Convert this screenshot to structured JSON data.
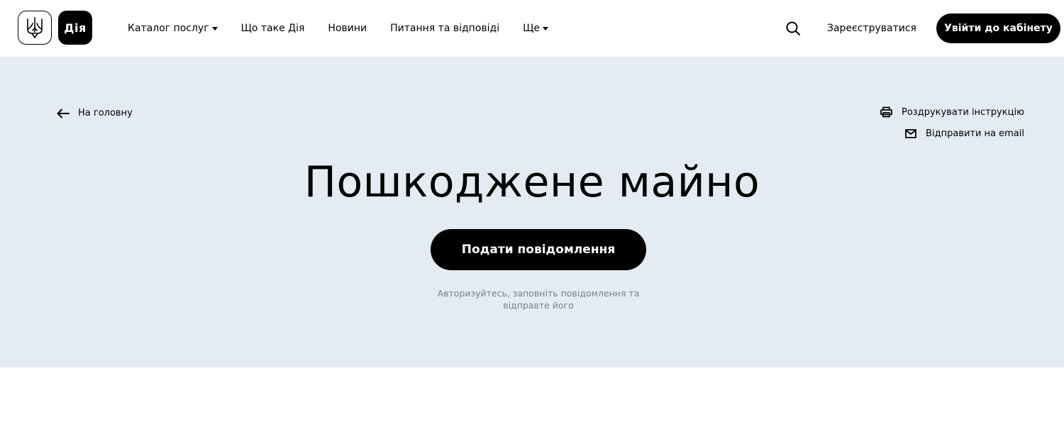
{
  "header": {
    "logo_text": "Дія",
    "nav": [
      {
        "label": "Каталог послуг",
        "has_dropdown": true
      },
      {
        "label": "Що таке Дія",
        "has_dropdown": false
      },
      {
        "label": "Новини",
        "has_dropdown": false
      },
      {
        "label": "Питання та відповіді",
        "has_dropdown": false
      },
      {
        "label": "Ще",
        "has_dropdown": true
      }
    ],
    "register_label": "Зареєструватися",
    "login_label": "Увійти до кабінету"
  },
  "hero": {
    "back_label": "На головну",
    "print_label": "Роздрукувати інструкцію",
    "email_label": "Відправити на email",
    "title": "Пошкоджене майно",
    "submit_label": "Подати повідомлення",
    "hint": "Авторизуйтесь, заповніть повідомлення та відправте його"
  },
  "colors": {
    "hero_background": "#e4ebf2",
    "primary": "#000000",
    "hint_text": "#7a7f86"
  },
  "icons": [
    "trident-logo-icon",
    "caret-down-icon",
    "search-icon",
    "arrow-left-icon",
    "printer-icon",
    "mail-icon"
  ]
}
